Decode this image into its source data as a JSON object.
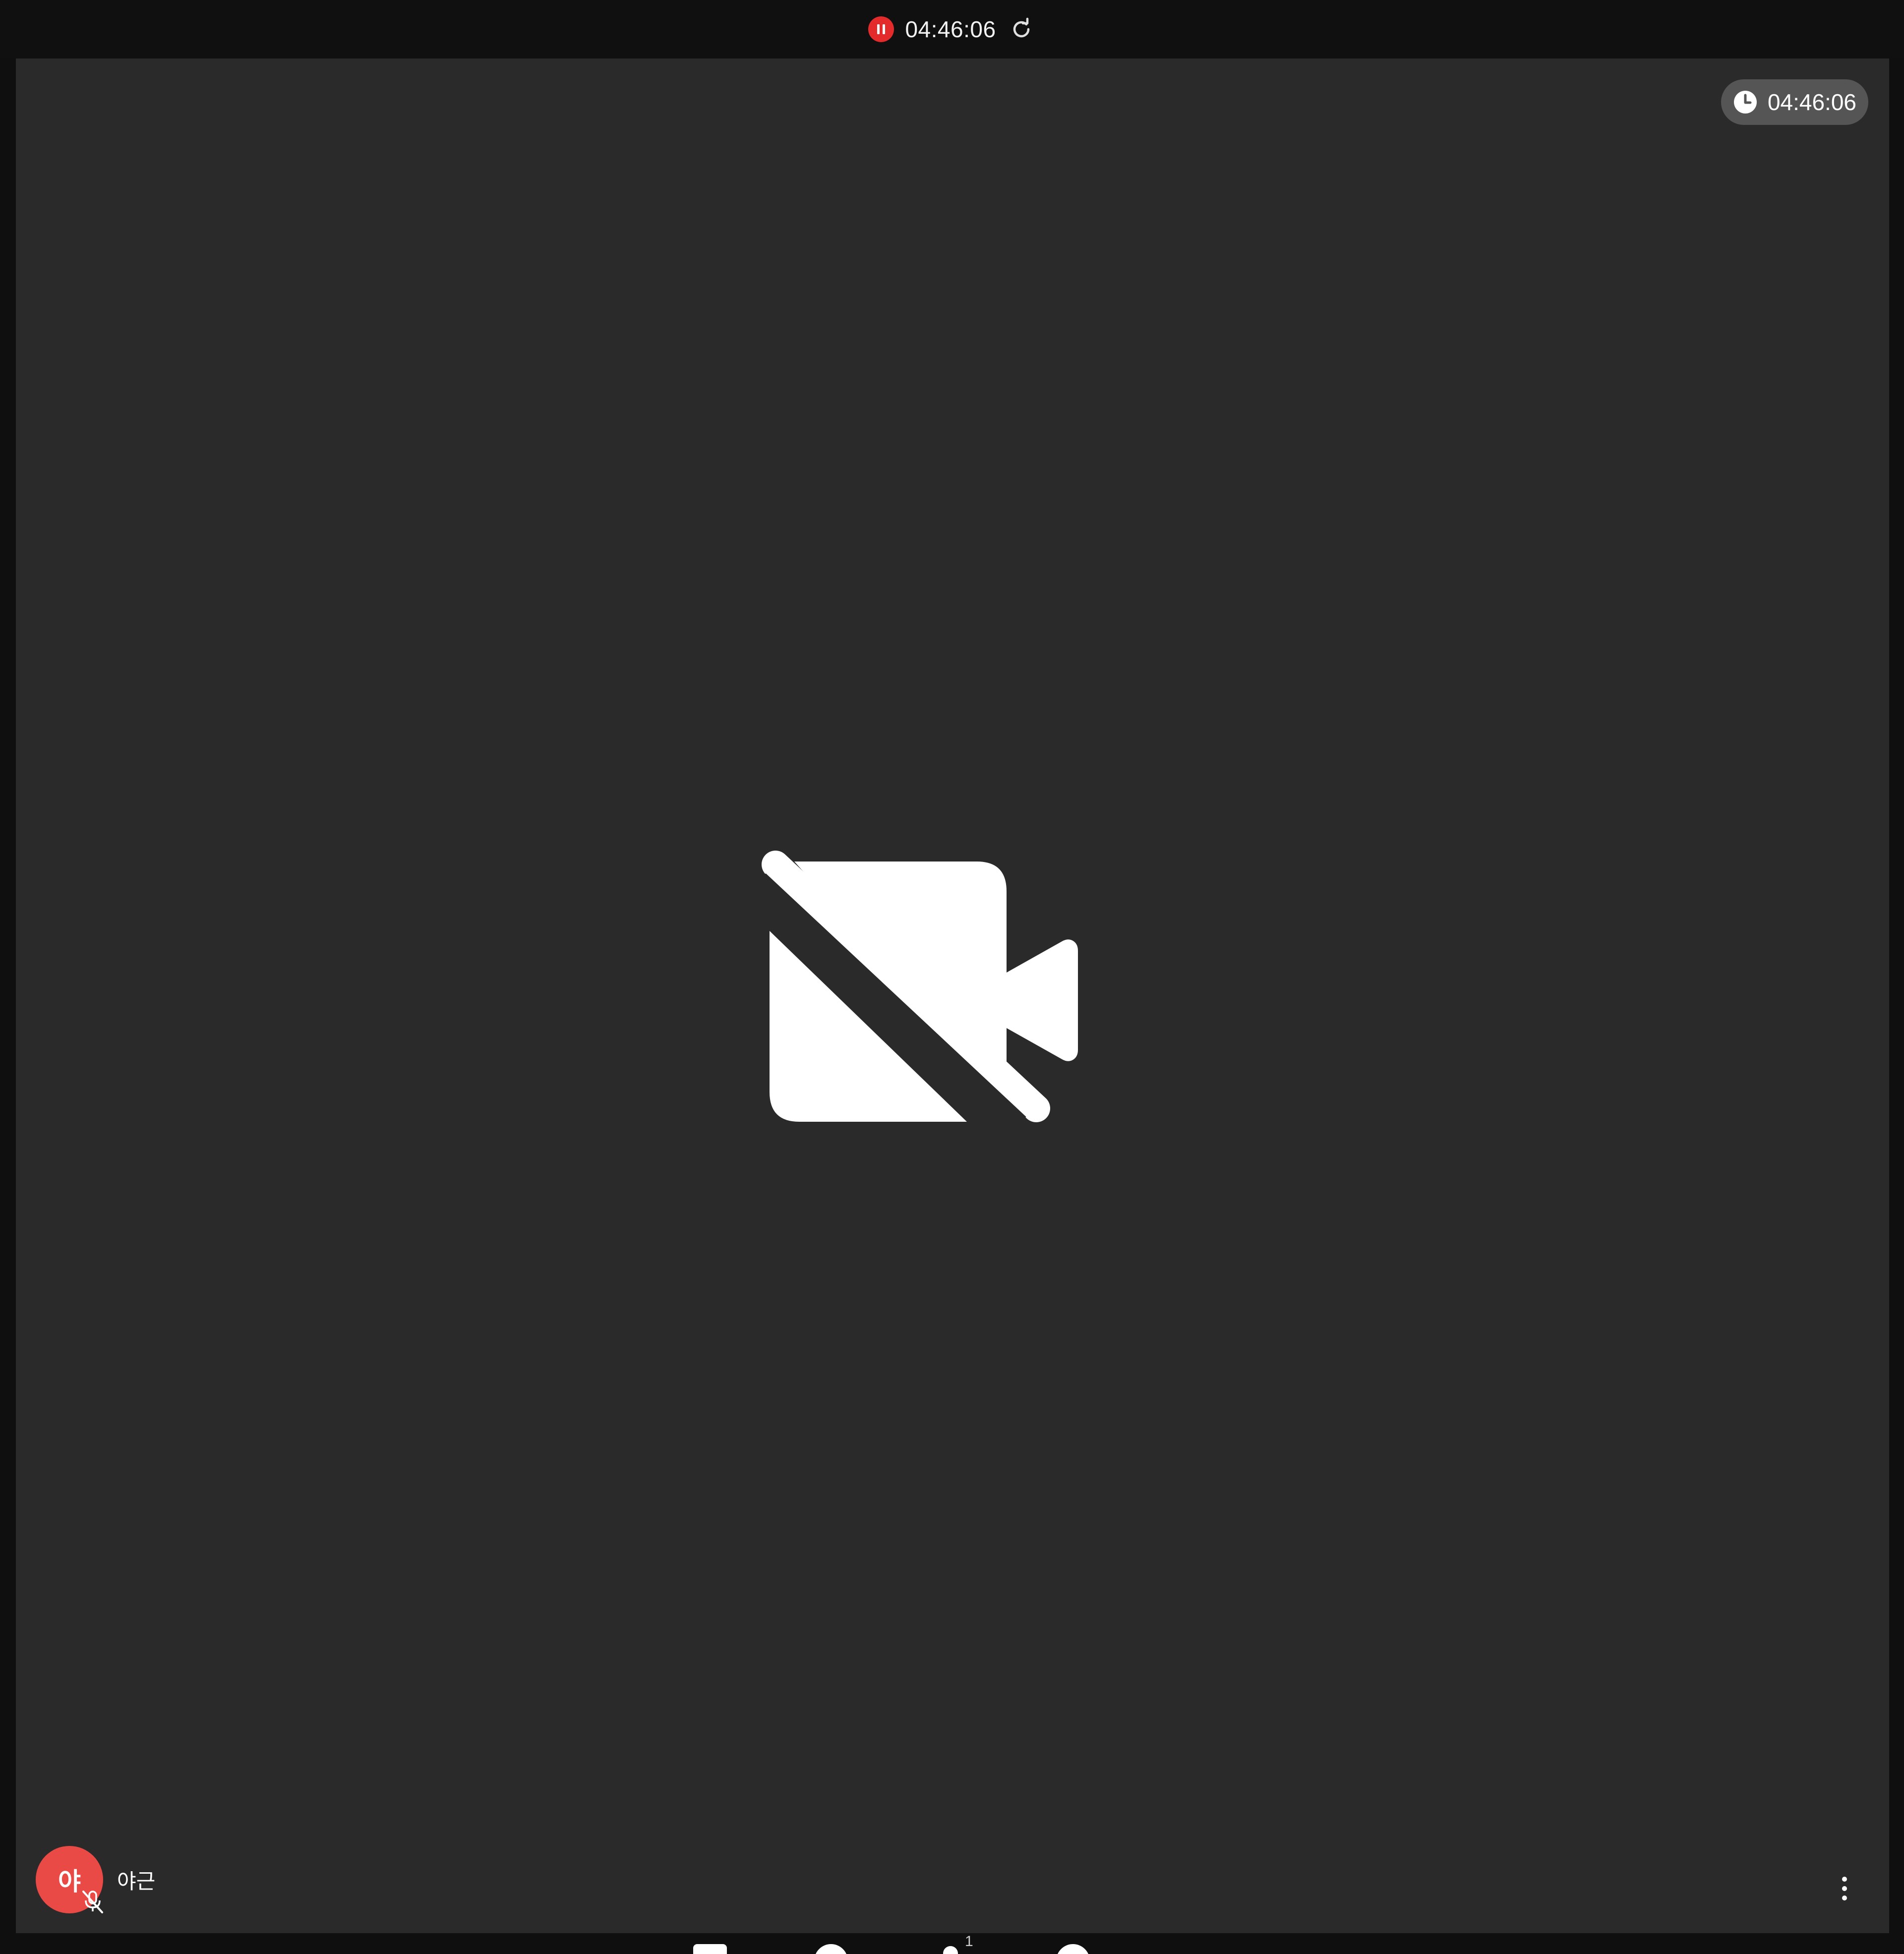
{
  "colors": {
    "recording_red": "#e32b2b",
    "avatar_red": "#ea4a45",
    "stage_bg": "#2a2a2a",
    "topbar_bg": "#101010"
  },
  "topbar": {
    "pause_icon": "pause-circle-icon",
    "elapsed_time": "04:46:06",
    "refresh_icon": "refresh-icon"
  },
  "stage": {
    "timer_icon": "clock-icon",
    "timer_text": "04:46:06",
    "camera_state_icon": "video-off-icon"
  },
  "participant": {
    "avatar_initial": "야",
    "name": "야근",
    "mic_icon": "mic-off-icon"
  },
  "more_menu_icon": "more-vertical-icon",
  "bottom_controls": {
    "participants_count": "1",
    "icons": [
      "square-button-icon",
      "circle-button-icon",
      "people-icon",
      "circle-button-icon"
    ]
  }
}
